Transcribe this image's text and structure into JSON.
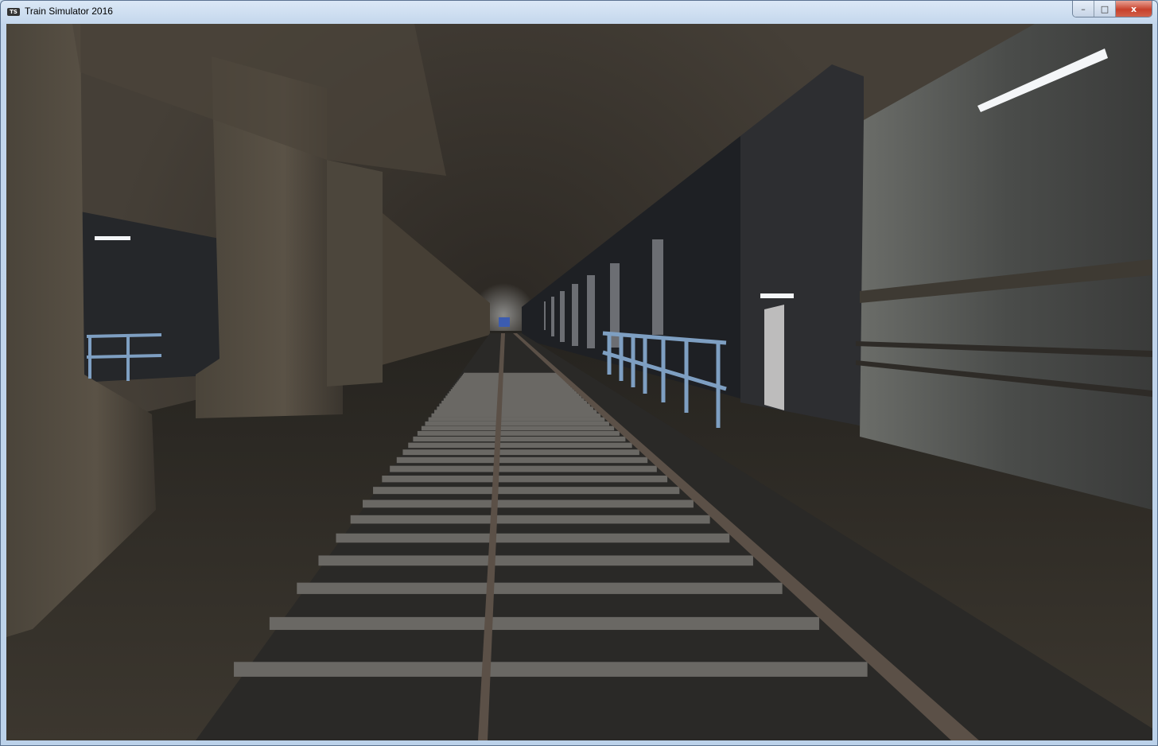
{
  "window": {
    "title": "Train Simulator 2016",
    "app_icon": "TS",
    "controls": {
      "minimize": "–",
      "maximize": "□",
      "close": "x"
    }
  },
  "scene": {
    "description_icon": "3d-subway-tunnel-view",
    "colors": {
      "ceiling": "#3f3a33",
      "floor": "#37332c",
      "wall": "#2c2c2e",
      "stone": "#5a5b58",
      "railing": "#7e9fc2",
      "rail": "#5b5047",
      "sleeper": "#6a6864",
      "ballast": "#2b2a28",
      "light": "#f4f6f8"
    }
  }
}
